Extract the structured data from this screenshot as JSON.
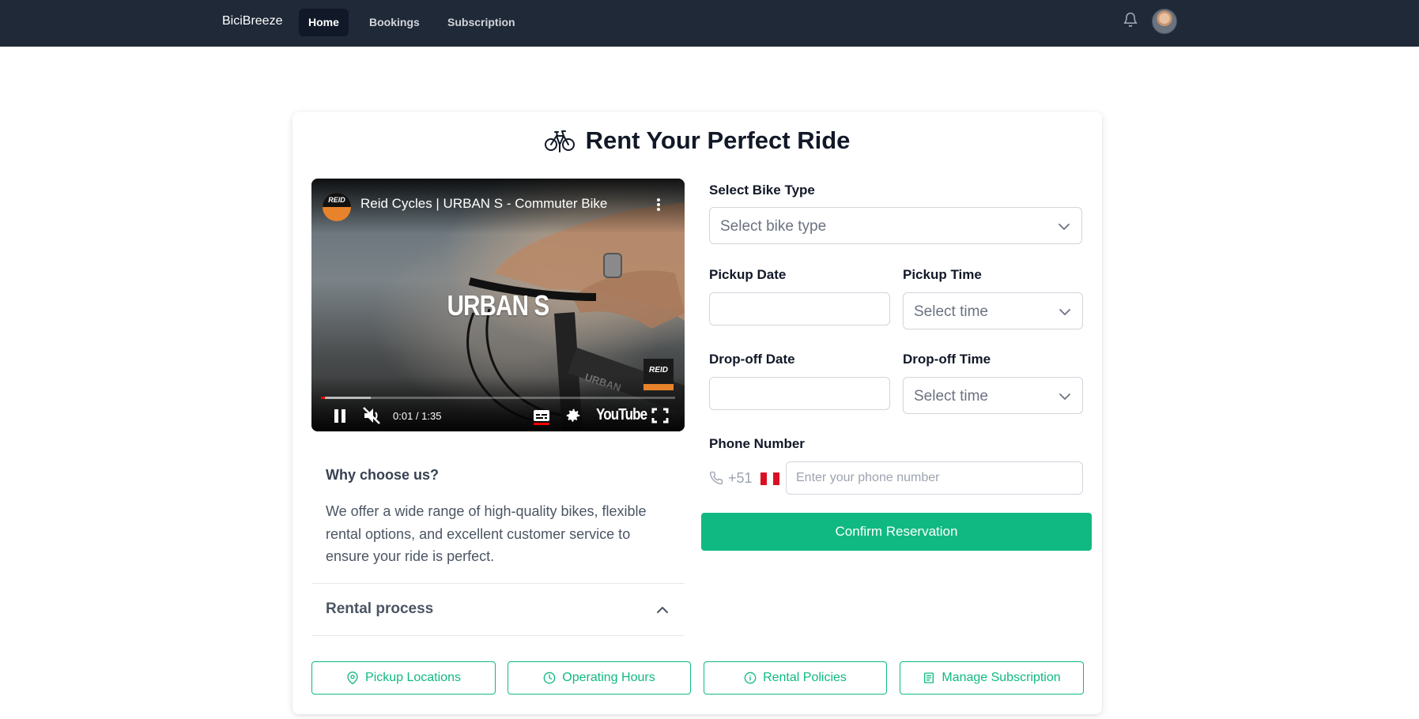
{
  "nav": {
    "brand": "BiciBreeze",
    "links": [
      {
        "label": "Home",
        "active": true
      },
      {
        "label": "Bookings",
        "active": false
      },
      {
        "label": "Subscription",
        "active": false
      }
    ],
    "bell_icon": "bell-icon",
    "avatar_icon": "user-avatar"
  },
  "page": {
    "title": "Rent Your Perfect Ride",
    "title_icon": "bicycle-icon"
  },
  "video": {
    "channel_badge": "REID",
    "title": "Reid Cycles | URBAN S - Commuter Bike",
    "overlay_text": "URBAN S",
    "watermark": "REID",
    "time": "0:01 / 1:35",
    "played_fraction": 0.004,
    "buffered_fraction": 0.14,
    "platform": "YouTube",
    "muted": true,
    "playing": true
  },
  "why": {
    "title": "Why choose us?",
    "text": "We offer a wide range of high-quality bikes, flexible rental options, and excellent customer service to ensure your ride is perfect."
  },
  "accordion": {
    "title": "Rental process",
    "expanded": true
  },
  "form": {
    "bike_type_label": "Select Bike Type",
    "bike_type_placeholder": "Select bike type",
    "pickup_date_label": "Pickup Date",
    "pickup_date_value": "",
    "pickup_time_label": "Pickup Time",
    "pickup_time_placeholder": "Select time",
    "dropoff_date_label": "Drop-off Date",
    "dropoff_date_value": "",
    "dropoff_time_label": "Drop-off Time",
    "dropoff_time_placeholder": "Select time",
    "phone_label": "Phone Number",
    "phone_code": "+51",
    "phone_placeholder": "Enter your phone number",
    "confirm_label": "Confirm Reservation"
  },
  "bottom_buttons": [
    {
      "label": "Pickup Locations",
      "icon": "map-pin-icon"
    },
    {
      "label": "Operating Hours",
      "icon": "clock-icon"
    },
    {
      "label": "Rental Policies",
      "icon": "info-icon"
    },
    {
      "label": "Manage Subscription",
      "icon": "document-icon"
    }
  ],
  "colors": {
    "nav_bg": "#1f2937",
    "accent_green": "#10b981",
    "progress_red": "#ff0000",
    "flag_red": "#d91023"
  }
}
